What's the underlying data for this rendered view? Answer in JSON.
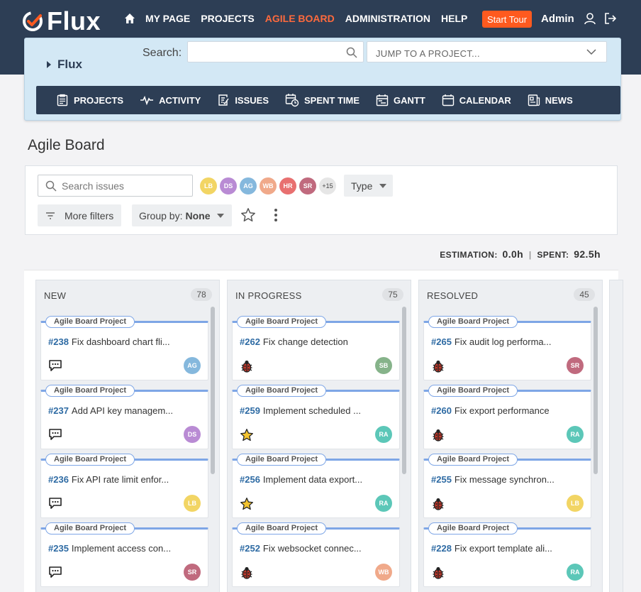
{
  "app": {
    "logo_text": "Flux",
    "nav": [
      "MY PAGE",
      "PROJECTS",
      "AGILE BOARD",
      "ADMINISTRATION",
      "HELP"
    ],
    "active_nav": "AGILE BOARD",
    "start_tour": "Start Tour",
    "user": "Admin"
  },
  "project": {
    "name": "Flux",
    "search_label": "Search:",
    "search_value": "",
    "jump_placeholder": "JUMP TO A PROJECT...",
    "menu": [
      {
        "label": "PROJECTS",
        "icon": "projects-icon"
      },
      {
        "label": "ACTIVITY",
        "icon": "activity-icon"
      },
      {
        "label": "ISSUES",
        "icon": "issues-icon"
      },
      {
        "label": "SPENT TIME",
        "icon": "spent-time-icon"
      },
      {
        "label": "GANTT",
        "icon": "gantt-icon"
      },
      {
        "label": "CALENDAR",
        "icon": "calendar-icon"
      },
      {
        "label": "NEWS",
        "icon": "news-icon"
      }
    ]
  },
  "page": {
    "title": "Agile Board"
  },
  "filters": {
    "search_placeholder": "Search issues",
    "avatars": [
      {
        "initials": "LB",
        "color": "#f2d564"
      },
      {
        "initials": "DS",
        "color": "#b98bd4"
      },
      {
        "initials": "AG",
        "color": "#85b8dd"
      },
      {
        "initials": "WB",
        "color": "#f0a98a"
      },
      {
        "initials": "HR",
        "color": "#e87070"
      },
      {
        "initials": "SR",
        "color": "#c06a7e"
      }
    ],
    "more_count": "+15",
    "type_label": "Type",
    "more_filters": "More filters",
    "group_by_label": "Group by:",
    "group_by_value": "None"
  },
  "totals": {
    "estimation_label": "ESTIMATION:",
    "estimation_value": "0.0h",
    "spent_label": "SPENT:",
    "spent_value": "92.5h"
  },
  "columns": [
    {
      "name": "NEW",
      "count": "78",
      "cards": [
        {
          "project": "Agile Board Project",
          "id": "#238",
          "title": "Fix dashboard chart fli...",
          "type": "comment",
          "avatar": "AG",
          "color": "#85b8dd"
        },
        {
          "project": "Agile Board Project",
          "id": "#237",
          "title": "Add API key managem...",
          "type": "comment",
          "avatar": "DS",
          "color": "#b98bd4"
        },
        {
          "project": "Agile Board Project",
          "id": "#236",
          "title": "Fix API rate limit enfor...",
          "type": "comment",
          "avatar": "LB",
          "color": "#f2d564"
        },
        {
          "project": "Agile Board Project",
          "id": "#235",
          "title": "Implement access con...",
          "type": "comment",
          "avatar": "SR",
          "color": "#c06a7e"
        }
      ]
    },
    {
      "name": "IN PROGRESS",
      "count": "75",
      "cards": [
        {
          "project": "Agile Board Project",
          "id": "#262",
          "title": "Fix change detection",
          "type": "bug",
          "avatar": "SB",
          "color": "#86b38a"
        },
        {
          "project": "Agile Board Project",
          "id": "#259",
          "title": "Implement scheduled ...",
          "type": "star",
          "avatar": "RA",
          "color": "#5cc7b8"
        },
        {
          "project": "Agile Board Project",
          "id": "#256",
          "title": "Implement data export...",
          "type": "star",
          "avatar": "RA",
          "color": "#5cc7b8"
        },
        {
          "project": "Agile Board Project",
          "id": "#252",
          "title": "Fix websocket connec...",
          "type": "bug",
          "avatar": "WB",
          "color": "#f0a98a"
        }
      ]
    },
    {
      "name": "RESOLVED",
      "count": "45",
      "cards": [
        {
          "project": "Agile Board Project",
          "id": "#265",
          "title": "Fix audit log performa...",
          "type": "bug",
          "avatar": "SR",
          "color": "#c06a7e"
        },
        {
          "project": "Agile Board Project",
          "id": "#260",
          "title": "Fix export performance",
          "type": "bug",
          "avatar": "RA",
          "color": "#5cc7b8"
        },
        {
          "project": "Agile Board Project",
          "id": "#255",
          "title": "Fix message synchron...",
          "type": "bug",
          "avatar": "LB",
          "color": "#f2d564"
        },
        {
          "project": "Agile Board Project",
          "id": "#228",
          "title": "Fix export template ali...",
          "type": "bug",
          "avatar": "RA",
          "color": "#5cc7b8"
        }
      ]
    }
  ]
}
